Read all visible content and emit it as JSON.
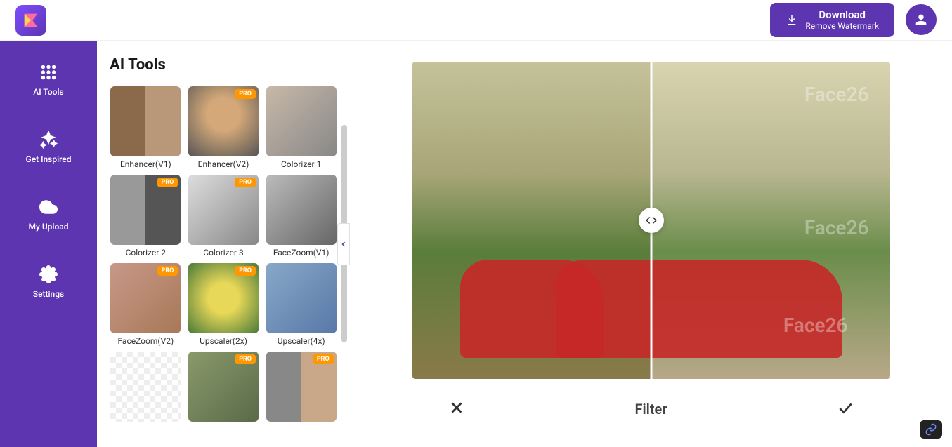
{
  "header": {
    "download_label": "Download",
    "download_sub": "Remove Watermark"
  },
  "sidebar": {
    "items": [
      {
        "label": "AI Tools"
      },
      {
        "label": "Get Inspired"
      },
      {
        "label": "My Upload"
      },
      {
        "label": "Settings"
      }
    ]
  },
  "tools": {
    "title": "AI Tools",
    "pro_label": "PRO",
    "items": [
      {
        "label": "Enhancer(V1)",
        "pro": false,
        "thumb": "th-enhancer1"
      },
      {
        "label": "Enhancer(V2)",
        "pro": true,
        "thumb": "th-enhancer2"
      },
      {
        "label": "Colorizer 1",
        "pro": false,
        "thumb": "th-colorizer1"
      },
      {
        "label": "Colorizer 2",
        "pro": true,
        "thumb": "th-colorizer2"
      },
      {
        "label": "Colorizer 3",
        "pro": true,
        "thumb": "th-colorizer3"
      },
      {
        "label": "FaceZoom(V1)",
        "pro": false,
        "thumb": "th-facezoom1"
      },
      {
        "label": "FaceZoom(V2)",
        "pro": true,
        "thumb": "th-facezoom2"
      },
      {
        "label": "Upscaler(2x)",
        "pro": true,
        "thumb": "th-upscaler2"
      },
      {
        "label": "Upscaler(4x)",
        "pro": false,
        "thumb": "th-upscaler4"
      },
      {
        "label": "",
        "pro": false,
        "thumb": "th-bg1"
      },
      {
        "label": "",
        "pro": true,
        "thumb": "th-bg2"
      },
      {
        "label": "",
        "pro": true,
        "thumb": "th-bg3"
      }
    ]
  },
  "preview": {
    "watermark": "Face26",
    "action_label": "Filter"
  }
}
